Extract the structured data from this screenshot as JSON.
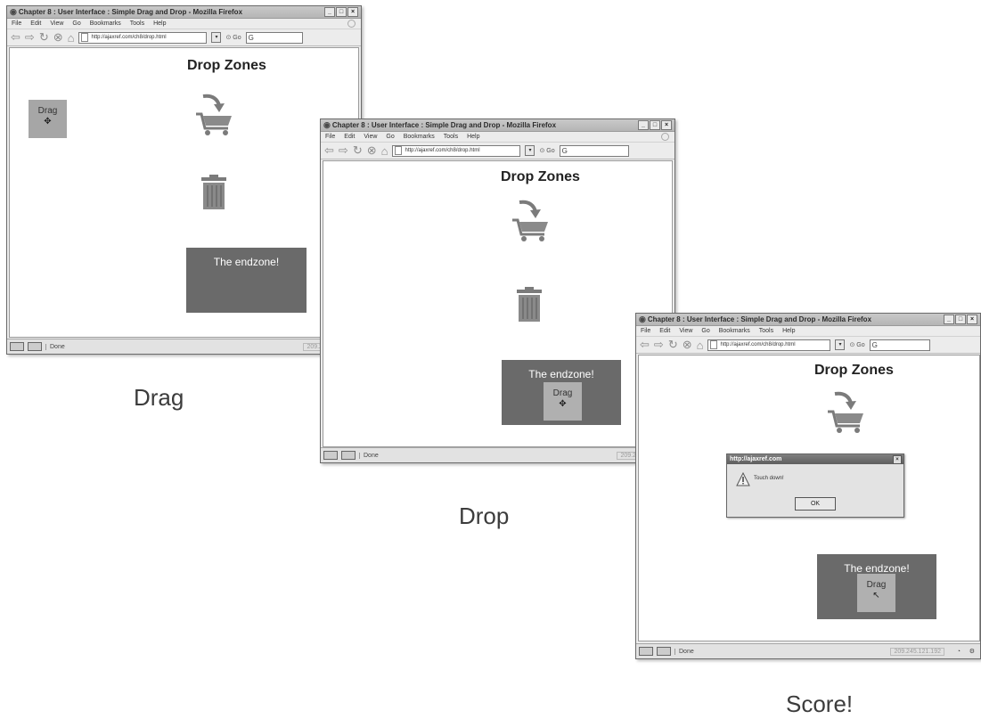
{
  "browser": {
    "title": "Chapter 8 : User Interface : Simple Drag and Drop - Mozilla Firefox",
    "menu": [
      "File",
      "Edit",
      "View",
      "Go",
      "Bookmarks",
      "Tools",
      "Help"
    ],
    "url": "http://ajaxref.com/ch8/drop.html",
    "go_label": "Go",
    "search_placeholder": "G",
    "status": "Done",
    "ip": "209.245.121.192",
    "window_controls": [
      "_",
      "□",
      "×"
    ]
  },
  "page": {
    "heading": "Drop Zones",
    "drag_label": "Drag",
    "drag_move_glyph": "✥",
    "endzone_label": "The endzone!",
    "icons": [
      "cart-icon",
      "trash-icon"
    ]
  },
  "alert": {
    "title": "http://ajaxref.com",
    "message": "Touch down!",
    "ok": "OK"
  },
  "captions": {
    "drag": "Drag",
    "drop": "Drop",
    "score": "Score!"
  },
  "colors": {
    "drag_box": "#a6a6a6",
    "endzone": "#6a6a6a",
    "icon_gray": "#7b7b7b"
  }
}
